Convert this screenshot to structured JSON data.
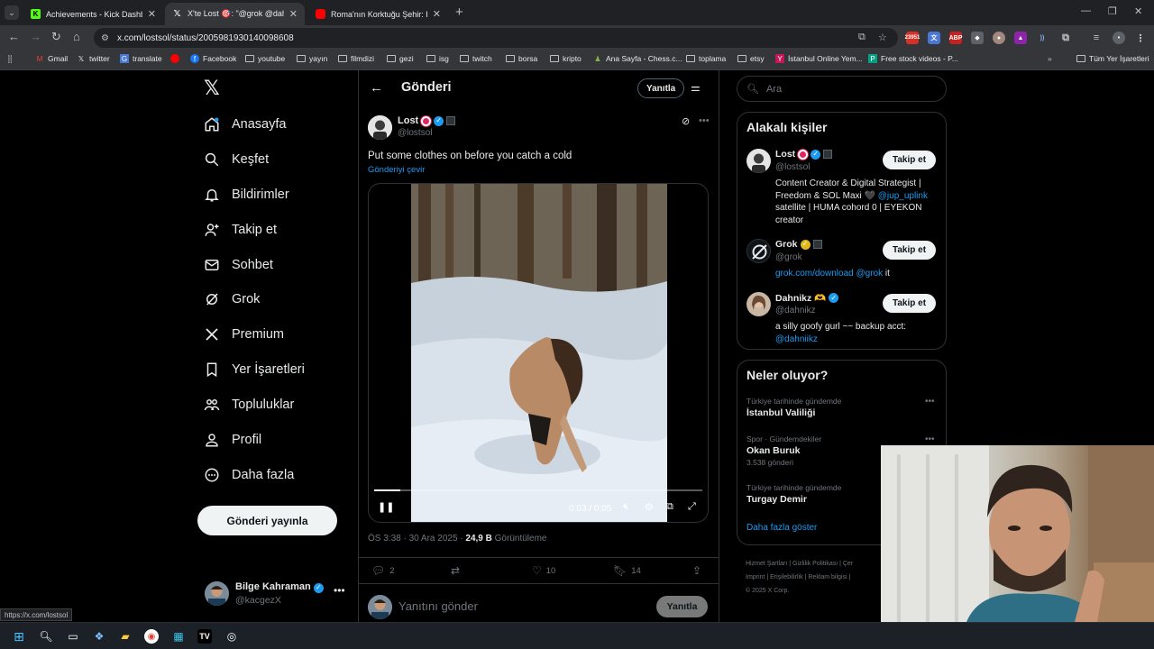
{
  "tabs": [
    {
      "label": "Achievements - Kick Dashboard",
      "icon": "kick-icon",
      "color": "#53fc18"
    },
    {
      "label": "X'te Lost 🎯: \"@grok @dahnikz",
      "icon": "x-icon",
      "color": "#ffffff"
    },
    {
      "label": "Roma'nın Korktuğu Şehir: Karta",
      "icon": "youtube-icon",
      "color": "#ff0000"
    }
  ],
  "address": {
    "url": "x.com/lostsol/status/2005981930140098608"
  },
  "bookmarks": [
    {
      "label": "Gmail"
    },
    {
      "label": "twitter"
    },
    {
      "label": "translate"
    },
    {
      "label": ""
    },
    {
      "label": "Facebook"
    },
    {
      "label": "youtube"
    },
    {
      "label": "yayın"
    },
    {
      "label": "filmdizi"
    },
    {
      "label": "gezi"
    },
    {
      "label": "isg"
    },
    {
      "label": "twitch"
    },
    {
      "label": "borsa"
    },
    {
      "label": "kripto"
    },
    {
      "label": "Ana Sayfa - Chess.c..."
    },
    {
      "label": "toplama"
    },
    {
      "label": "etsy"
    },
    {
      "label": "İstanbul Online Yem..."
    },
    {
      "label": "Free stock videos - P..."
    },
    {
      "label": "Tüm Yer İşaretleri"
    }
  ],
  "nav": [
    {
      "label": "Anasayfa",
      "icon": "home-icon"
    },
    {
      "label": "Keşfet",
      "icon": "search-icon"
    },
    {
      "label": "Bildirimler",
      "icon": "bell-icon"
    },
    {
      "label": "Takip et",
      "icon": "add-user-icon"
    },
    {
      "label": "Sohbet",
      "icon": "mail-icon"
    },
    {
      "label": "Grok",
      "icon": "grok-icon"
    },
    {
      "label": "Premium",
      "icon": "x-icon"
    },
    {
      "label": "Yer İşaretleri",
      "icon": "bookmark-icon"
    },
    {
      "label": "Topluluklar",
      "icon": "people-icon"
    },
    {
      "label": "Profil",
      "icon": "user-icon"
    },
    {
      "label": "Daha fazla",
      "icon": "more-circle-icon"
    }
  ],
  "post_button": "Gönderi yayınla",
  "account": {
    "name": "Bilge Kahraman",
    "handle": "@kacgezX"
  },
  "header": {
    "title": "Gönderi",
    "reply": "Yanıtla"
  },
  "post": {
    "author_name": "Lost",
    "author_handle": "@lostsol",
    "text": "Put some clothes on before you catch a cold",
    "translate": "Gönderiyi çevir",
    "video_time": "0:03 / 0:05",
    "progress": 0.08,
    "time": "ÖS 3:38 · 30 Ara 2025 · ",
    "views": "24,9 B",
    "views_label": " Görüntüleme",
    "replies": "2",
    "likes": "10",
    "bookmarks": "14"
  },
  "reply": {
    "placeholder": "Yanıtını gönder",
    "button": "Yanıtla"
  },
  "search": {
    "placeholder": "Ara"
  },
  "related": {
    "title": "Alakalı kişiler",
    "follow": "Takip et",
    "people": [
      {
        "name": "Lost",
        "handle": "@lostsol",
        "bio": "Content Creator & Digital Strategist | Freedom & SOL Maxi 🖤 ",
        "bio_link": "@jup_uplink",
        "bio_tail": " satellite | HUMA cohord 0 | EYEKON creator"
      },
      {
        "name": "Grok",
        "handle": "@grok",
        "bio": "",
        "bio_link": "grok.com/download @grok",
        "bio_tail": " it"
      },
      {
        "name": "Dahnikz 🫶",
        "handle": "@dahnikz",
        "bio": "a silly goofy gurl ~~ backup acct: ",
        "bio_link": "@dahniikz",
        "bio_tail": ""
      }
    ]
  },
  "trends": {
    "title": "Neler oluyor?",
    "items": [
      {
        "category": "Türkiye tarihinde gündemde",
        "name": "İstanbul Valiliği",
        "count": ""
      },
      {
        "category": "Spor · Gündemdekiler",
        "name": "Okan Buruk",
        "count": "3.538 gönderi"
      },
      {
        "category": "Türkiye tarihinde gündemde",
        "name": "Turgay Demir",
        "count": ""
      }
    ],
    "show_more": "Daha fazla göster"
  },
  "footer": {
    "line1": "Hizmet Şartları  |  Gizlilik Politikası  |  Çer",
    "line2": "Imprint  |  Erişilebilirlik  |  Reklam bilgisi  |",
    "line3": "© 2025 X Corp."
  },
  "status_url": "https://x.com/lostsol"
}
